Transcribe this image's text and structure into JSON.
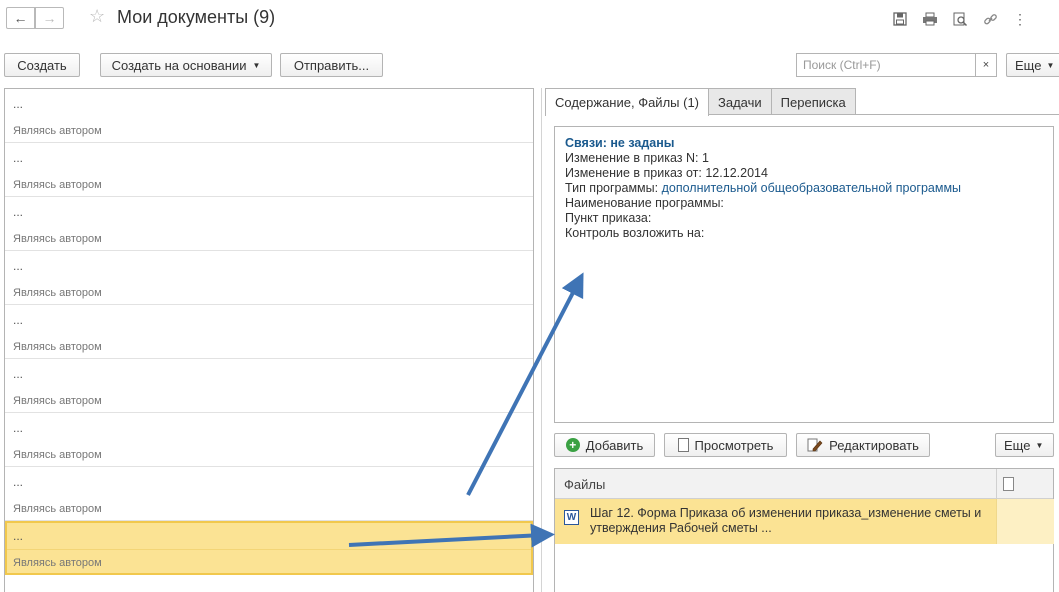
{
  "window": {
    "title": "Мои документы (9)"
  },
  "toolbar": {
    "create_label": "Создать",
    "create_based_label": "Создать на основании",
    "send_label": "Отправить...",
    "search_placeholder": "Поиск (Ctrl+F)",
    "search_value": "",
    "clear_label": "×",
    "more_label": "Еще"
  },
  "list": {
    "items": [
      {
        "title": "...",
        "role": "Являясь автором"
      },
      {
        "title": "...",
        "role": "Являясь автором"
      },
      {
        "title": "...",
        "role": "Являясь автором"
      },
      {
        "title": "...",
        "role": "Являясь автором"
      },
      {
        "title": "...",
        "role": "Являясь автором"
      },
      {
        "title": "...",
        "role": "Являясь автором"
      },
      {
        "title": "...",
        "role": "Являясь автором"
      },
      {
        "title": "...",
        "role": "Являясь автором"
      },
      {
        "title": "...",
        "role": "Являясь автором"
      }
    ],
    "selected_index": 8
  },
  "tabs": [
    {
      "label": "Содержание, Файлы (1)",
      "active": true
    },
    {
      "label": "Задачи",
      "active": false
    },
    {
      "label": "Переписка",
      "active": false
    }
  ],
  "content": {
    "links": "Связи: не заданы",
    "lines": [
      {
        "label": "Изменение в приказ N: ",
        "value": "1"
      },
      {
        "label": "Изменение в приказ от: ",
        "value": "12.12.2014"
      },
      {
        "label": "Тип программы: ",
        "value": "дополнительной общеобразовательной программы"
      },
      {
        "label": "Наименование программы:",
        "value": ""
      },
      {
        "label": "Пункт приказа:",
        "value": ""
      },
      {
        "label": "Контроль возложить на:",
        "value": ""
      }
    ]
  },
  "files_toolbar": {
    "add_label": "Добавить",
    "view_label": "Просмотреть",
    "edit_label": "Редактировать",
    "more_label": "Еще"
  },
  "files": {
    "header": "Файлы",
    "rows": [
      {
        "icon": "word-icon",
        "name": "Шаг 12. Форма Приказа об изменении приказа_изменение сметы и утверждения Рабочей сметы ..."
      }
    ]
  },
  "colors": {
    "selection": "#fbe394",
    "selection_border": "#f1c84d",
    "link": "#1b5a8e",
    "arrow": "#3f74b5",
    "add_icon": "#3aa143"
  }
}
